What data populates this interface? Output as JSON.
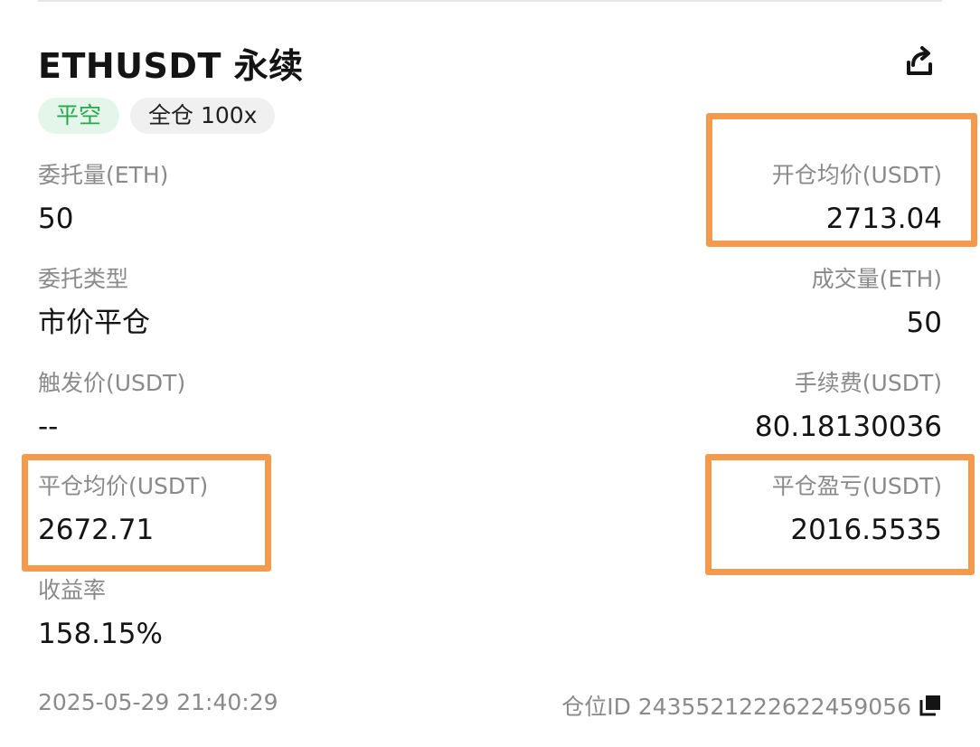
{
  "header": {
    "title": "ETHUSDT 永续",
    "share_icon": "share-icon"
  },
  "badges": {
    "side": "平空",
    "margin": "全仓 100x"
  },
  "fields": {
    "order_qty": {
      "label": "委托量(ETH)",
      "value": "50"
    },
    "open_avg_price": {
      "label": "开仓均价(USDT)",
      "value": "2713.04"
    },
    "order_type": {
      "label": "委托类型",
      "value": "市价平仓"
    },
    "filled_qty": {
      "label": "成交量(ETH)",
      "value": "50"
    },
    "trigger_price": {
      "label": "触发价(USDT)",
      "value": "--"
    },
    "fee": {
      "label": "手续费(USDT)",
      "value": "80.18130036"
    },
    "close_avg_price": {
      "label": "平仓均价(USDT)",
      "value": "2672.71"
    },
    "close_pnl": {
      "label": "平仓盈亏(USDT)",
      "value": "2016.5535"
    },
    "roi": {
      "label": "收益率",
      "value": "158.15%"
    }
  },
  "footer": {
    "timestamp": "2025-05-29 21:40:29",
    "position_id": "仓位ID 2435521222622459056",
    "copy_icon": "copy-icon"
  },
  "colors": {
    "accent_green": "#27a84c",
    "highlight_orange": "#f39a4c",
    "label_gray": "#8a8a8a"
  }
}
